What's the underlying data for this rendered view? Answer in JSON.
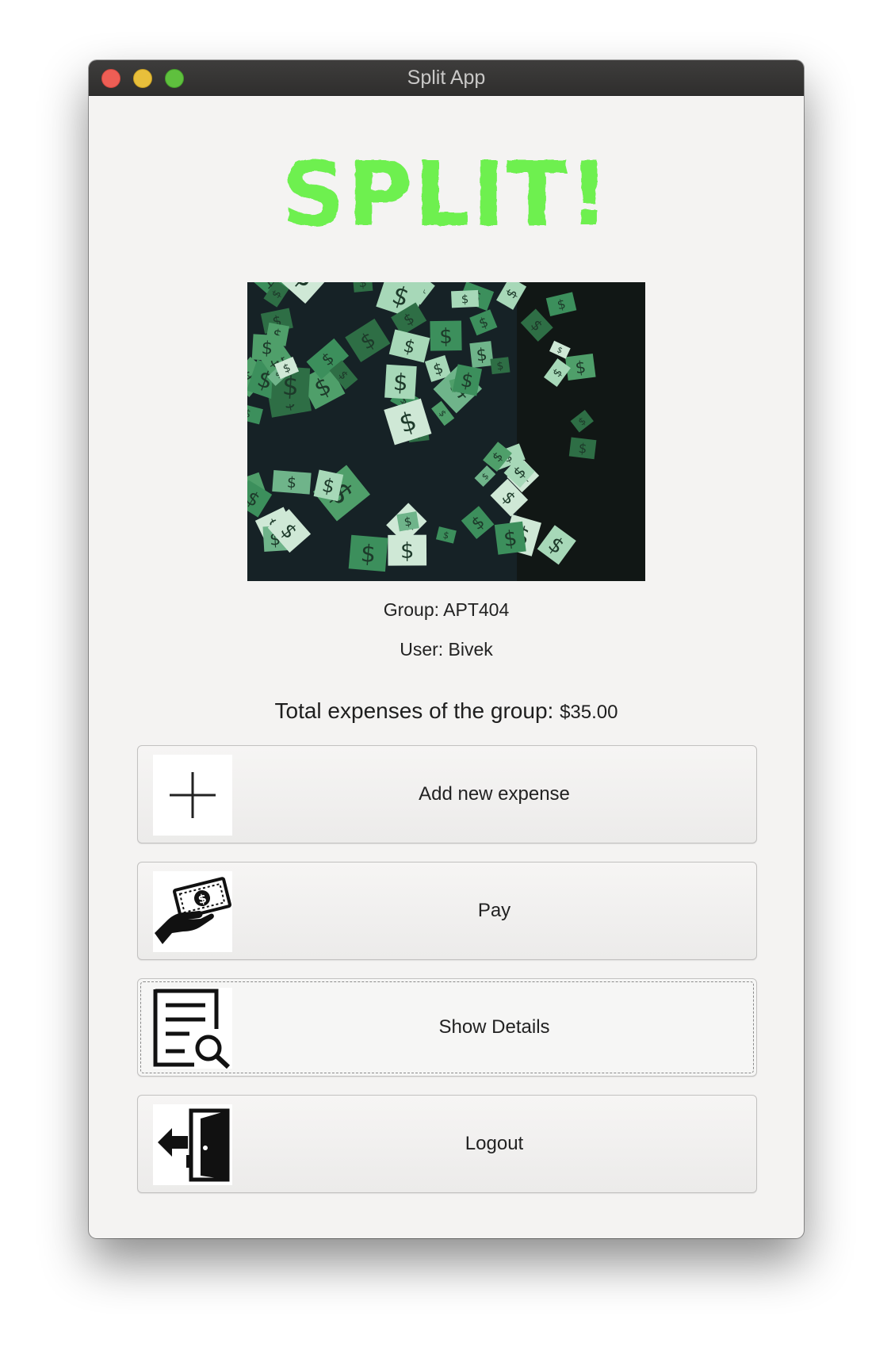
{
  "window": {
    "title": "Split App"
  },
  "logo": {
    "text": "SPLIT!",
    "color": "#6ef04f"
  },
  "image": {
    "description_icon": "falling-money-image"
  },
  "info": {
    "group": "Group: APT404",
    "user": "User: Bivek",
    "total_label": "Total expenses of the group: ",
    "total_amount": "$35.00"
  },
  "buttons": [
    {
      "label": "Add new expense",
      "icon": "plus-icon"
    },
    {
      "label": "Pay",
      "icon": "hand-money-icon"
    },
    {
      "label": "Show Details",
      "icon": "document-search-icon"
    },
    {
      "label": "Logout",
      "icon": "exit-door-icon"
    }
  ]
}
